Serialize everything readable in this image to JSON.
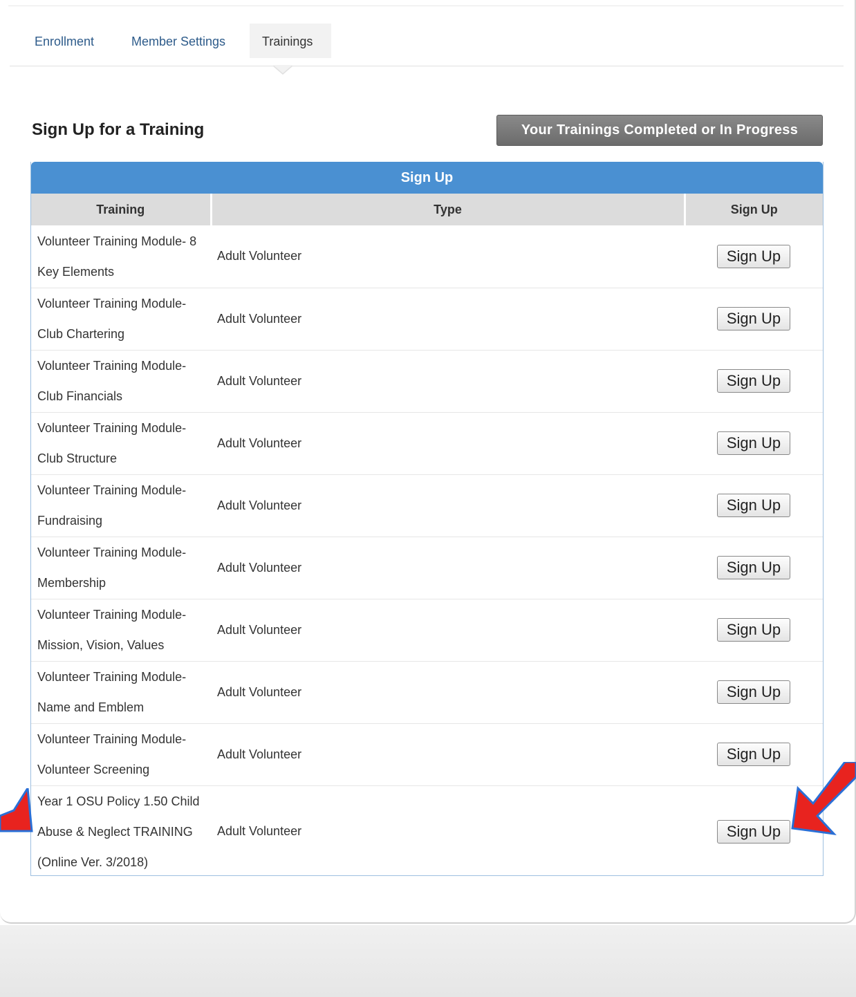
{
  "tabs": [
    {
      "label": "Enrollment",
      "active": false
    },
    {
      "label": "Member Settings",
      "active": false
    },
    {
      "label": "Trainings",
      "active": true
    }
  ],
  "section_title": "Sign Up for a Training",
  "completed_button": "Your Trainings Completed or In Progress",
  "table": {
    "caption": "Sign Up",
    "columns": [
      "Training",
      "Type",
      "Sign Up"
    ],
    "rows": [
      {
        "training": "Volunteer Training Module- 8 Key Elements",
        "type": "Adult Volunteer",
        "action": "Sign Up"
      },
      {
        "training": "Volunteer Training Module- Club Chartering",
        "type": "Adult Volunteer",
        "action": "Sign Up"
      },
      {
        "training": "Volunteer Training Module- Club Financials",
        "type": "Adult Volunteer",
        "action": "Sign Up"
      },
      {
        "training": "Volunteer Training Module- Club Structure",
        "type": "Adult Volunteer",
        "action": "Sign Up"
      },
      {
        "training": "Volunteer Training Module- Fundraising",
        "type": "Adult Volunteer",
        "action": "Sign Up"
      },
      {
        "training": "Volunteer Training Module- Membership",
        "type": "Adult Volunteer",
        "action": "Sign Up"
      },
      {
        "training": "Volunteer Training Module- Mission, Vision, Values",
        "type": "Adult Volunteer",
        "action": "Sign Up"
      },
      {
        "training": "Volunteer Training Module- Name and Emblem",
        "type": "Adult Volunteer",
        "action": "Sign Up"
      },
      {
        "training": "Volunteer Training Module- Volunteer Screening",
        "type": "Adult Volunteer",
        "action": "Sign Up"
      },
      {
        "training": "Year 1 OSU Policy 1.50 Child Abuse & Neglect TRAINING (Online Ver. 3/2018)",
        "type": "Adult Volunteer",
        "action": "Sign Up"
      }
    ]
  },
  "annotations": {
    "arrow_color": "#e8231f",
    "arrow_outline": "#2a6fd6"
  }
}
